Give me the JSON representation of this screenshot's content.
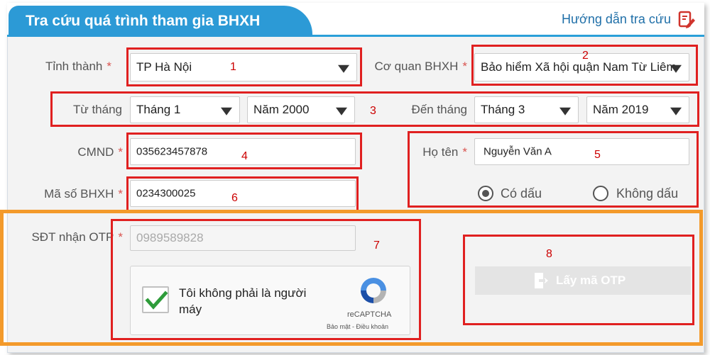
{
  "header": {
    "title": "Tra cứu quá trình tham gia BHXH",
    "help_link": "Hướng dẫn tra cứu",
    "help_icon": "edit-document-icon"
  },
  "form": {
    "province": {
      "label": "Tỉnh thành",
      "required": "*",
      "value": "TP Hà Nội"
    },
    "agency": {
      "label": "Cơ quan BHXH",
      "required": "*",
      "value": "Bảo hiểm Xã hội quận Nam Từ Liêm"
    },
    "from": {
      "label": "Từ tháng",
      "month": "Tháng 1",
      "year": "Năm 2000"
    },
    "to": {
      "label": "Đến tháng",
      "month": "Tháng 3",
      "year": "Năm 2019"
    },
    "id_card": {
      "label": "CMND",
      "required": "*",
      "value": "035623457878"
    },
    "full_name": {
      "label": "Họ tên",
      "required": "*",
      "value": "Nguyễn Văn A"
    },
    "name_accent": {
      "options": [
        "Có dấu",
        "Không dấu"
      ],
      "selected": "Có dấu"
    },
    "insurance_code": {
      "label": "Mã số BHXH",
      "required": "*",
      "value": "0234300025"
    },
    "otp_phone": {
      "label": "SĐT nhận OTP",
      "required": "*",
      "placeholder": "0989589828"
    }
  },
  "captcha": {
    "text": "Tôi không phải là người máy",
    "brand": "reCAPTCHA",
    "links": "Bảo mật - Điều khoản",
    "checked": true
  },
  "otp_button": {
    "label": "Lấy mã OTP",
    "icon": "sign-in-icon"
  },
  "annotations": [
    "1",
    "2",
    "3",
    "4",
    "5",
    "6",
    "7",
    "8"
  ],
  "colors": {
    "header": "#2c9ad6",
    "annotation_red": "#e02020",
    "annotation_orange": "#f39a2b",
    "check_green": "#2e9c3a"
  }
}
